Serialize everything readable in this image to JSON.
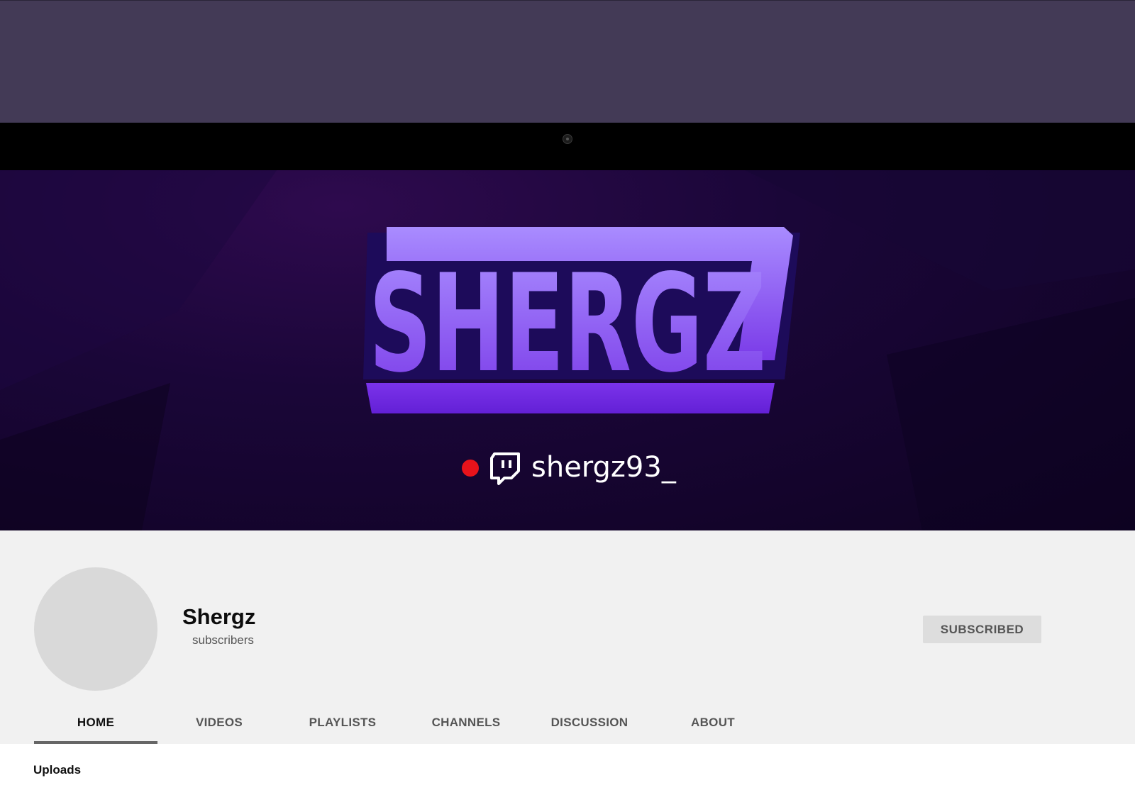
{
  "channel": {
    "name": "Shergz",
    "subscribers_label": "subscribers",
    "subscribe_button_label": "SUBSCRIBED"
  },
  "banner": {
    "logo_text": "SHERGZ",
    "twitch_handle": "shergz93_",
    "accent_colors": {
      "logo_light": "#a58bff",
      "logo_dark": "#6a28e0",
      "live_dot": "#e8131b"
    }
  },
  "tabs": [
    {
      "label": "HOME",
      "active": true
    },
    {
      "label": "VIDEOS",
      "active": false
    },
    {
      "label": "PLAYLISTS",
      "active": false
    },
    {
      "label": "CHANNELS",
      "active": false
    },
    {
      "label": "DISCUSSION",
      "active": false
    },
    {
      "label": "ABOUT",
      "active": false
    }
  ],
  "sections": {
    "uploads_title": "Uploads"
  },
  "icons": [
    "camera-icon",
    "live-dot-icon",
    "twitch-icon"
  ]
}
